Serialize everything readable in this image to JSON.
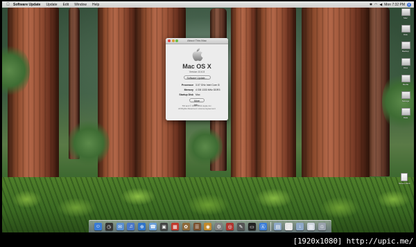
{
  "menubar": {
    "apple_glyph": "",
    "app_name": "Software Update",
    "menus": [
      "Update",
      "Edit",
      "Window",
      "Help"
    ],
    "clock": "Mon 7:32 PM"
  },
  "about_window": {
    "title": "About This Mac",
    "os_name": "Mac OS X",
    "version": "Version 10.6.8",
    "software_update_button": "Software Update...",
    "rows": [
      {
        "key": "Processor",
        "value": "3.07 GHz Intel Core i3"
      },
      {
        "key": "Memory",
        "value": "4 GB 1333 MHz DDR3"
      },
      {
        "key": "Startup Disk",
        "value": "Mac"
      }
    ],
    "more_info_button": "More Info...",
    "copyright": "TM and © 1983–2011 Apple Inc.\nAll Rights Reserved.  License Agreement"
  },
  "desktop_icons": [
    {
      "label": "Mac",
      "icon": "hard-drive-icon"
    },
    {
      "label": "Disk",
      "icon": "hard-drive-icon"
    },
    {
      "label": "Backup",
      "icon": "hard-drive-icon"
    },
    {
      "label": "Files",
      "icon": "hard-drive-icon"
    },
    {
      "label": "Media",
      "icon": "hard-drive-icon"
    },
    {
      "label": "Storage",
      "icon": "hard-drive-icon"
    },
    {
      "label": "Data",
      "icon": "hard-drive-icon"
    },
    {
      "label": "Screen Shot",
      "icon": "document-icon"
    }
  ],
  "dock": {
    "items": [
      {
        "name": "finder-icon",
        "glyph": "☺",
        "color": "#3a7bd5"
      },
      {
        "name": "dashboard-icon",
        "glyph": "◷",
        "color": "#333333"
      },
      {
        "name": "mail-icon",
        "glyph": "✉",
        "color": "#5a8fd0"
      },
      {
        "name": "itunes-icon",
        "glyph": "♫",
        "color": "#4a78c8"
      },
      {
        "name": "safari-icon",
        "glyph": "⊕",
        "color": "#2f74c9"
      },
      {
        "name": "messages-icon",
        "glyph": "☎",
        "color": "#6a9ed8"
      },
      {
        "name": "facetime-icon",
        "glyph": "▣",
        "color": "#444444"
      },
      {
        "name": "calendar-icon",
        "glyph": "▦",
        "color": "#c0392b"
      },
      {
        "name": "photos-icon",
        "glyph": "✿",
        "color": "#8e6a3a"
      },
      {
        "name": "address-book-icon",
        "glyph": "☰",
        "color": "#7a5230"
      },
      {
        "name": "preview-icon",
        "glyph": "◉",
        "color": "#c28a2b"
      },
      {
        "name": "system-preferences-icon",
        "glyph": "⚙",
        "color": "#7f7f7f"
      },
      {
        "name": "photo-booth-icon",
        "glyph": "◎",
        "color": "#b0352f"
      },
      {
        "name": "text-edit-icon",
        "glyph": "✎",
        "color": "#555555"
      },
      {
        "name": "terminal-icon",
        "glyph": "▭",
        "color": "#222222"
      },
      {
        "name": "app-store-icon",
        "glyph": "Ⓐ",
        "color": "#3b7dd8"
      }
    ],
    "right_items": [
      {
        "name": "applications-folder-icon",
        "glyph": "▤",
        "color": "#8fa9c8"
      },
      {
        "name": "document-icon",
        "glyph": "▯",
        "color": "#e6e6e6"
      },
      {
        "name": "downloads-folder-icon",
        "glyph": "↓",
        "color": "#8fa9c8"
      },
      {
        "name": "screenshot-stack-icon",
        "glyph": "▥",
        "color": "#cfd6df"
      },
      {
        "name": "trash-icon",
        "glyph": "♲",
        "color": "#9aa3ad"
      }
    ]
  },
  "watermark": "[1920x1080] http://upic.me/"
}
